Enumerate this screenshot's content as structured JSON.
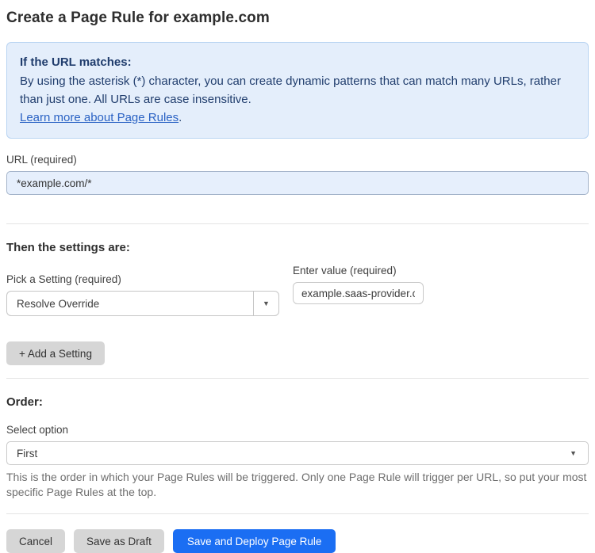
{
  "page": {
    "title": "Create a Page Rule for example.com"
  },
  "info_box": {
    "heading": "If the URL matches:",
    "body": "By using the asterisk (*) character, you can create dynamic patterns that can match many URLs, rather than just one. All URLs are case insensitive.",
    "link_text": "Learn more about Page Rules",
    "link_suffix": "."
  },
  "url_field": {
    "label": "URL (required)",
    "value": "*example.com/*"
  },
  "settings_section": {
    "heading": "Then the settings are:",
    "setting_label": "Pick a Setting (required)",
    "setting_selected": "Resolve Override",
    "value_label": "Enter value (required)",
    "value_text": "example.saas-provider.c",
    "add_setting_label": "+ Add a Setting",
    "caret": "▼"
  },
  "order_section": {
    "heading": "Order:",
    "select_label": "Select option",
    "selected": "First",
    "help": "This is the order in which your Page Rules will be triggered. Only one Page Rule will trigger per URL, so put your most specific Page Rules at the top.",
    "caret": "▼"
  },
  "footer": {
    "cancel_label": "Cancel",
    "save_draft_label": "Save as Draft",
    "save_deploy_label": "Save and Deploy Page Rule"
  },
  "colors": {
    "info_box_bg": "#e4eefb",
    "info_box_border": "#b9d4f2",
    "info_text": "#203d6d",
    "link_blue": "#2a62c4",
    "url_input_bg": "#e6effc",
    "primary_button_blue": "#1b6ef3",
    "gray_button_bg": "#d6d6d6"
  }
}
